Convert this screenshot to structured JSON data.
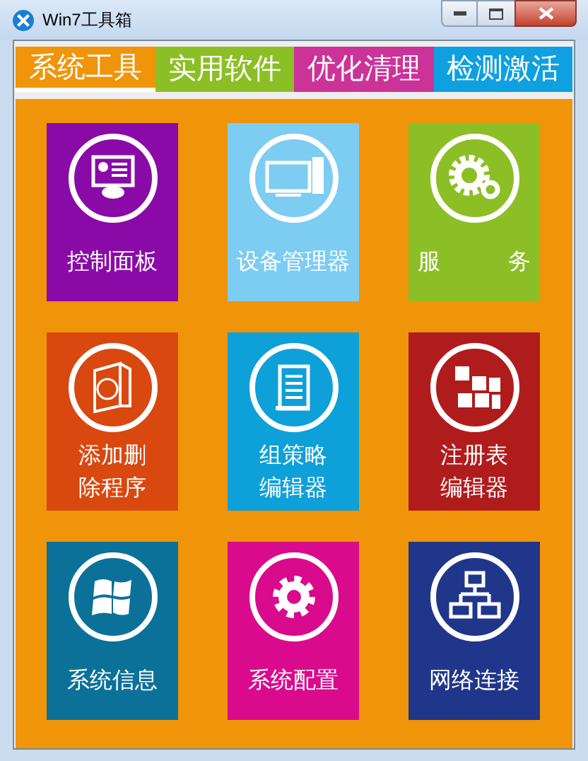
{
  "window": {
    "title": "Win7工具箱"
  },
  "tabs": [
    {
      "label": "系统工具",
      "color": "#f0940a",
      "selected": true
    },
    {
      "label": "实用软件",
      "color": "#8cbf26",
      "selected": false
    },
    {
      "label": "优化清理",
      "color": "#cc3399",
      "selected": false
    },
    {
      "label": "检测激活",
      "color": "#0ea0e0",
      "selected": false
    }
  ],
  "tiles": [
    {
      "label": "控制面板",
      "color": "#8a0aa8"
    },
    {
      "label": "设备管理器",
      "color": "#7dccf2"
    },
    {
      "label": "服　　　务",
      "color": "#8cbf26"
    },
    {
      "label": "添加删除程序",
      "color": "#d9480f"
    },
    {
      "label": "组策略编辑器",
      "color": "#0ea0d8"
    },
    {
      "label": "注册表编辑器",
      "color": "#b01c1c"
    },
    {
      "label": "系统信息",
      "color": "#0b7199"
    },
    {
      "label": "系统配置",
      "color": "#d90b8c"
    },
    {
      "label": "网络连接",
      "color": "#20368a"
    }
  ]
}
